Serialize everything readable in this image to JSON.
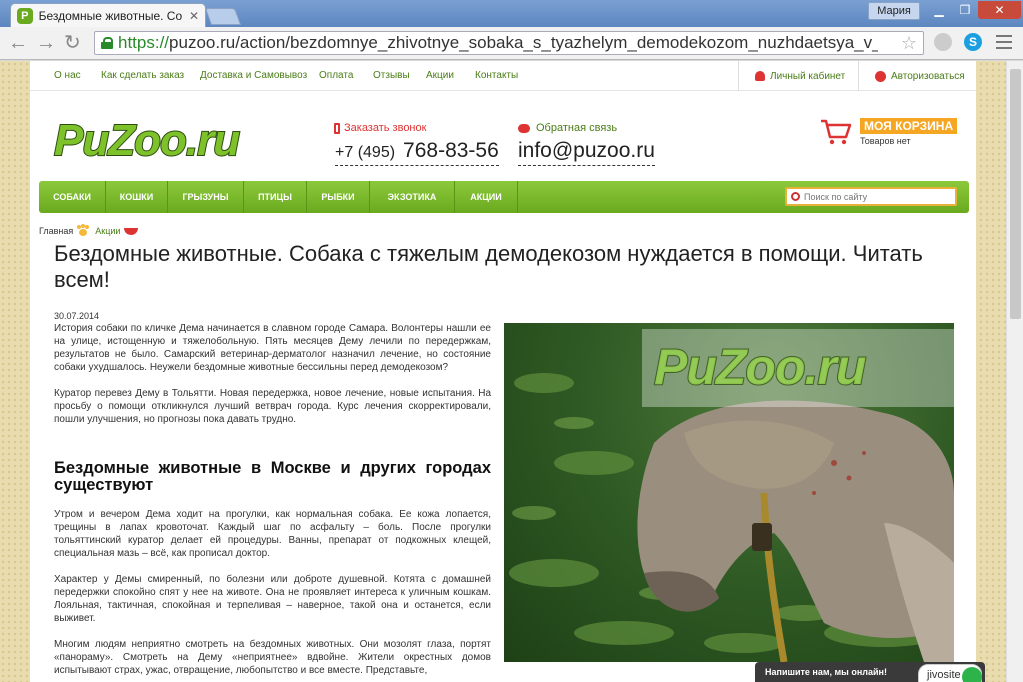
{
  "browser": {
    "tab_title": "Бездомные животные. Со",
    "tab_close": "✕",
    "favicon_letter": "P",
    "user_name": "Мария",
    "win_min": "▁",
    "win_max": "❐",
    "win_close": "✕",
    "url_scheme": "https://",
    "url_rest": "puzoo.ru/action/bezdomnye_zhivotnye_sobaka_s_tyazhelym_demodekozom_nuzhdaetsya_v_pomoshi",
    "back": "←",
    "forward": "→",
    "reload": "↻",
    "star": "☆",
    "skype_letter": "S"
  },
  "topnav": {
    "items": [
      "О нас",
      "Как сделать заказ",
      "Доставка и Самовывоз",
      "Оплата",
      "Отзывы",
      "Акции",
      "Контакты"
    ],
    "cabinet": "Личный кабинет",
    "login": "Авторизоваться"
  },
  "header": {
    "logo": "PuZoo.ru",
    "callback": "Заказать звонок",
    "phone_code": "+7 (495)",
    "phone_number": "768-83-56",
    "feedback": "Обратная связь",
    "email": "info@puzoo.ru",
    "cart_title": "МОЯ КОРЗИНА",
    "cart_status": "Товаров нет"
  },
  "catnav": {
    "items": [
      "СОБАКИ",
      "КОШКИ",
      "ГРЫЗУНЫ",
      "ПТИЦЫ",
      "РЫБКИ",
      "ЭКЗОТИКА",
      "АКЦИИ"
    ],
    "search_placeholder": "Поиск по сайту"
  },
  "breadcrumb": {
    "home": "Главная",
    "current": "Акции"
  },
  "article": {
    "title": "Бездомные животные. Собака с тяжелым демодекозом нуждается в помощи. Читать всем!",
    "date": "30.07.2014",
    "p1": "История собаки по кличке Дема начинается в славном городе Самара. Волонтеры нашли ее на улице, истощенную и тяжелобольную. Пять месяцев Дему лечили по передержкам, результатов не было. Самарский ветеринар-дерматолог назначил лечение, но состояние собаки ухудшалось. Неужели бездомные животные бессильны перед демодекозом?",
    "p2": "Куратор перевез Дему в Тольятти. Новая передержка, новое лечение, новые испытания. На просьбу о помощи откликнулся лучший ветврач города. Курс лечения скорректировали, пошли улучшения, но прогнозы пока давать трудно.",
    "h2": "Бездомные животные в Москве и других городах существуют",
    "p3": "Утром и вечером Дема ходит на прогулки, как нормальная собака. Ее кожа лопается, трещины в лапах кровоточат. Каждый шаг по асфальту – боль. После прогулки тольяттинский куратор делает ей процедуры. Ванны, препарат от подкожных клещей, специальная мазь – всё, как прописал доктор.",
    "p4": "Характер у Демы смиренный, по болезни или доброте душевной. Котята с домашней передержки спокойно спят у нее на животе. Она не проявляет интереса к уличным кошкам. Лояльная, тактичная, спокойная и терпеливая – наверное, такой она и останется, если выживет.",
    "p5": "Многим людям неприятно смотреть на бездомных животных. Они мозолят глаза, портят «панораму». Смотреть на Дему «неприятнее» вдвойне. Жители окрестных домов испытывают страх, ужас, отвращение, любопытство и все вместе. Представьте,",
    "watermark": "PuZoo.ru"
  },
  "chat": {
    "label": "Напишите нам, мы онлайн!",
    "brand": "jivosite"
  }
}
